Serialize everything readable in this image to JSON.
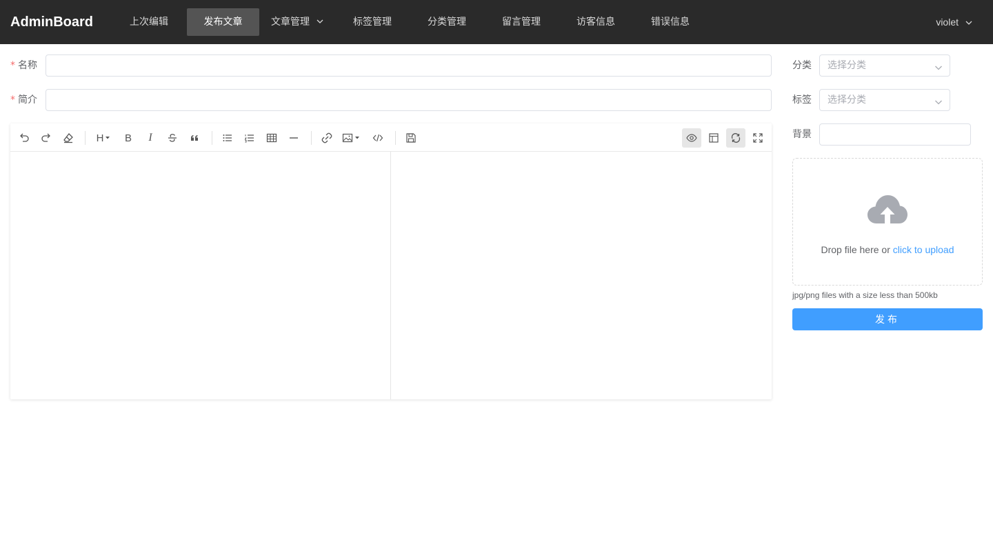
{
  "header": {
    "logo": "AdminBoard",
    "nav": [
      {
        "label": "上次编辑"
      },
      {
        "label": "发布文章"
      },
      {
        "label": "文章管理"
      },
      {
        "label": "标签管理"
      },
      {
        "label": "分类管理"
      },
      {
        "label": "留言管理"
      },
      {
        "label": "访客信息"
      },
      {
        "label": "错误信息"
      }
    ],
    "user": "violet",
    "bg_color": "#2a2a2a",
    "active_color": "#545454"
  },
  "form": {
    "name_label": "名称",
    "name_value": "",
    "summary_label": "简介",
    "summary_value": "",
    "required_mark": "*",
    "category_label": "分类",
    "category_placeholder": "选择分类",
    "tag_label": "标签",
    "tag_placeholder": "选择分类",
    "background_label": "背景",
    "background_value": ""
  },
  "editor": {
    "toolbar_left": [
      "undo-icon",
      "redo-icon",
      "clear-icon",
      "heading-icon",
      "bold-icon",
      "italic-icon",
      "strikethrough-icon",
      "quote-icon",
      "unordered-list-icon",
      "ordered-list-icon",
      "table-icon",
      "horizontal-rule-icon",
      "link-icon",
      "image-icon",
      "code-icon",
      "save-icon"
    ],
    "toolbar_right": [
      "preview-icon",
      "toc-icon",
      "sync-scroll-icon",
      "fullscreen-icon"
    ],
    "heading_text": "H",
    "bold_text": "B",
    "italic_text": "I",
    "markdown_value": "",
    "preview_value": ""
  },
  "upload": {
    "drop_text": "Drop file here or ",
    "link_text": "click to upload",
    "tip": "jpg/png files with a size less than 500kb",
    "accent_color": "#409eff"
  },
  "publish_button": "发布"
}
